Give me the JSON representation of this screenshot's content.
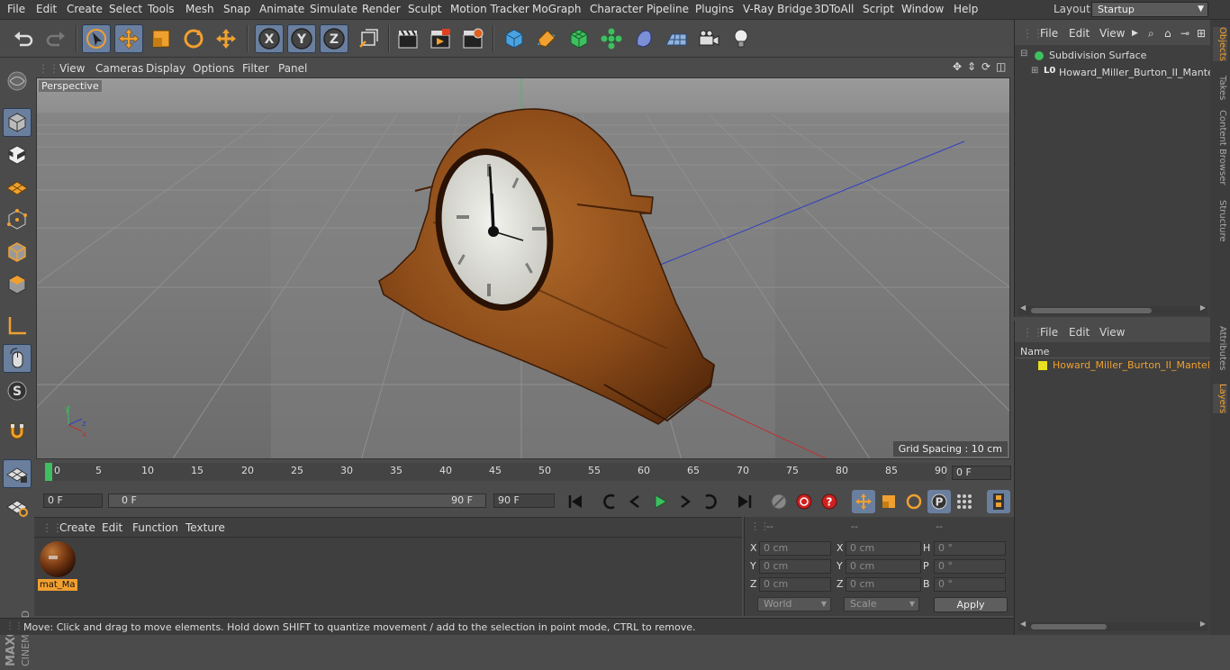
{
  "menubar": {
    "items": [
      "File",
      "Edit",
      "Create",
      "Select",
      "Tools",
      "Mesh",
      "Snap",
      "Animate",
      "Simulate",
      "Render",
      "Sculpt",
      "Motion Tracker",
      "MoGraph",
      "Character",
      "Pipeline",
      "Plugins",
      "V-Ray Bridge",
      "3DToAll",
      "Script",
      "Window",
      "Help"
    ],
    "layout_label": "Layout:",
    "layout_value": "Startup"
  },
  "viewport": {
    "menu": [
      "View",
      "Cameras",
      "Display",
      "Options",
      "Filter",
      "Panel"
    ],
    "label": "Perspective",
    "grid_spacing": "Grid Spacing : 10 cm"
  },
  "timeline": {
    "ticks": [
      "0",
      "5",
      "10",
      "15",
      "20",
      "25",
      "30",
      "35",
      "40",
      "45",
      "50",
      "55",
      "60",
      "65",
      "70",
      "75",
      "80",
      "85",
      "90"
    ],
    "current_frame": "0 F"
  },
  "transport": {
    "start_field": "0 F",
    "range_start": "0 F",
    "range_end": "90 F",
    "end_field": "90 F"
  },
  "material_panel": {
    "menu": [
      "Create",
      "Edit",
      "Function",
      "Texture"
    ],
    "material_name": "mat_Ma"
  },
  "coords": {
    "header": [
      "--",
      "--",
      "--"
    ],
    "rows": [
      {
        "a": "X",
        "av": "0 cm",
        "b": "X",
        "bv": "0 cm",
        "c": "H",
        "cv": "0 °"
      },
      {
        "a": "Y",
        "av": "0 cm",
        "b": "Y",
        "bv": "0 cm",
        "c": "P",
        "cv": "0 °"
      },
      {
        "a": "Z",
        "av": "0 cm",
        "b": "Z",
        "bv": "0 cm",
        "c": "B",
        "cv": "0 °"
      }
    ],
    "world": "World",
    "scale": "Scale",
    "apply": "Apply"
  },
  "status": "Move: Click and drag to move elements. Hold down SHIFT to quantize movement / add to the selection in point mode, CTRL to remove.",
  "objects_panel": {
    "menu": [
      "File",
      "Edit",
      "View"
    ],
    "items": [
      "Subdivision Surface",
      "Howard_Miller_Burton_II_Mantel"
    ]
  },
  "layers_panel": {
    "menu": [
      "File",
      "Edit",
      "View"
    ],
    "name_header": "Name",
    "item": "Howard_Miller_Burton_II_Mantel_"
  },
  "right_tabs": [
    "Objects",
    "Takes",
    "Content Browser",
    "Structure",
    "Attributes",
    "Layers"
  ],
  "colors": {
    "accent": "#f0a030",
    "selected": "#6a7f9e",
    "background": "#4b4b4b"
  }
}
